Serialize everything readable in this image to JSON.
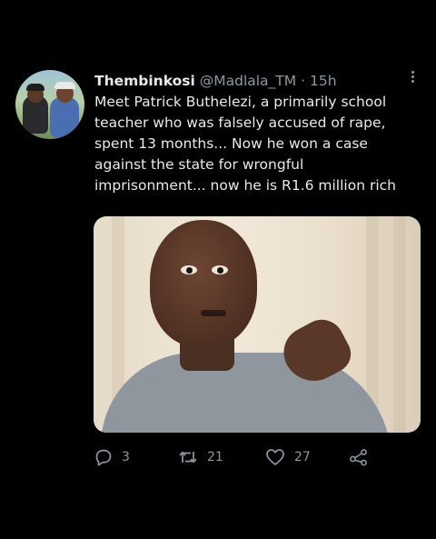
{
  "tweet": {
    "author": {
      "display_name": "Thembinkosi",
      "handle": "@Madlala_TM",
      "separator": "·",
      "time": "15h"
    },
    "text_lines": [
      "Meet Patrick Buthelezi, a primarily school",
      "teacher who was falsely accused of rape,",
      "spent 13 months... Now he won a case",
      "against the state for wrongful",
      "imprisonment... now he is R1.6 million rich"
    ],
    "actions": {
      "replies": "3",
      "retweets": "21",
      "likes": "27"
    },
    "icons": {
      "reply": "reply-icon",
      "retweet": "retweet-icon",
      "like": "heart-icon",
      "share": "share-icon",
      "more": "more-options-icon"
    }
  },
  "theme": {
    "background": "#000000",
    "text": "#e7e9ea",
    "muted": "#8b98a5"
  }
}
